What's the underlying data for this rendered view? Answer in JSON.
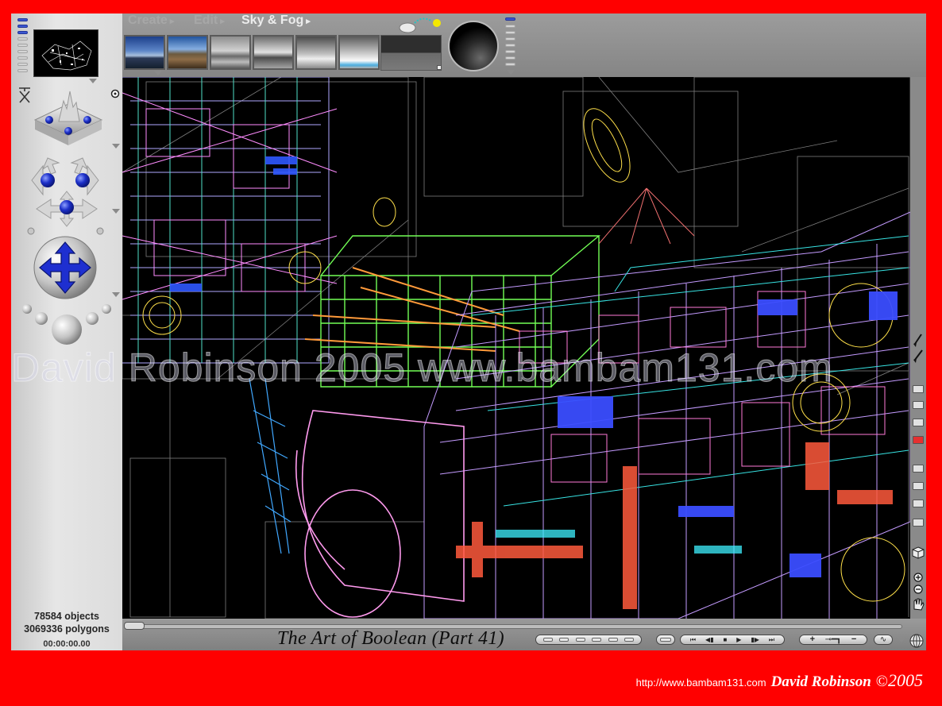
{
  "menu": {
    "tabs": [
      {
        "label": "Create",
        "active": false
      },
      {
        "label": "Edit",
        "active": false
      },
      {
        "label": "Sky & Fog",
        "active": true
      }
    ]
  },
  "stats": {
    "objects": "78584 objects",
    "polygons": "3069336 polygons",
    "time": "00:00:00.00"
  },
  "viewport": {
    "watermark": "David Robinson 2005 www.bambam131.com"
  },
  "bottom_bar": {
    "title": "The Art of Boolean (Part 41)"
  },
  "footer": {
    "url": "http://www.bambam131.com",
    "author": "David Robinson",
    "copyright_symbol": "©",
    "year": "2005"
  },
  "icons": [
    "hide-panel-icon",
    "camera-target-icon",
    "rotate-arrows-icon",
    "move-arrows-icon",
    "trackball-icon",
    "sun-icon",
    "cloud-icon",
    "paint-brush-icon",
    "cube-icon",
    "zoom-in-icon",
    "zoom-out-icon",
    "hand-pan-icon",
    "globe-icon",
    "key-icon"
  ],
  "colors": {
    "frame": "#ff0000",
    "panel": "#e0e0e0",
    "toolbar": "#8f8f8f",
    "viewport": "#000000",
    "accent_blue": "#2233cc"
  }
}
